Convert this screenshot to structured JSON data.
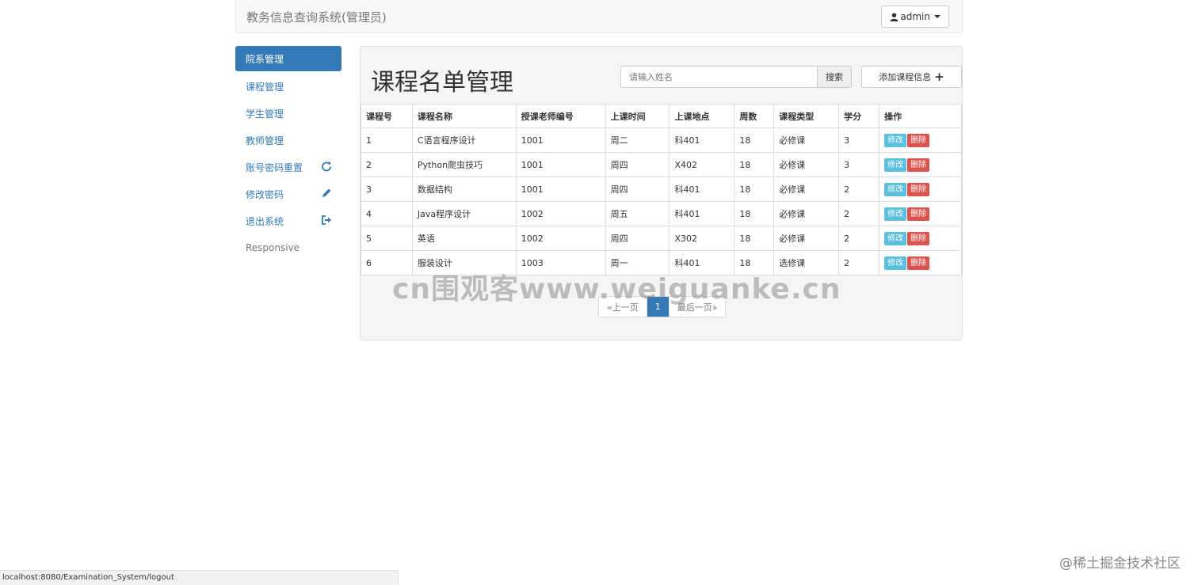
{
  "navbar": {
    "brand": "教务信息查询系统(管理员)",
    "user": "admin"
  },
  "sidebar": {
    "items": [
      {
        "label": "院系管理"
      },
      {
        "label": "课程管理"
      },
      {
        "label": "学生管理"
      },
      {
        "label": "教师管理"
      },
      {
        "label": "账号密码重置",
        "icon": "refresh-icon"
      },
      {
        "label": "修改密码",
        "icon": "pencil-icon"
      },
      {
        "label": "退出系统",
        "icon": "logout-icon"
      },
      {
        "label": "Responsive"
      }
    ]
  },
  "main": {
    "title": "课程名单管理",
    "search_placeholder": "请输入姓名",
    "search_label": "搜索",
    "add_label": "添加课程信息"
  },
  "table": {
    "headers": [
      "课程号",
      "课程名称",
      "授课老师编号",
      "上课时间",
      "上课地点",
      "周数",
      "课程类型",
      "学分",
      "操作"
    ],
    "rows": [
      [
        "1",
        "C语言程序设计",
        "1001",
        "周二",
        "科401",
        "18",
        "必修课",
        "3"
      ],
      [
        "2",
        "Python爬虫技巧",
        "1001",
        "周四",
        "X402",
        "18",
        "必修课",
        "3"
      ],
      [
        "3",
        "数据结构",
        "1001",
        "周四",
        "科401",
        "18",
        "必修课",
        "2"
      ],
      [
        "4",
        "Java程序设计",
        "1002",
        "周五",
        "科401",
        "18",
        "必修课",
        "2"
      ],
      [
        "5",
        "英语",
        "1002",
        "周四",
        "X302",
        "18",
        "必修课",
        "2"
      ],
      [
        "6",
        "服装设计",
        "1003",
        "周一",
        "科401",
        "18",
        "选修课",
        "2"
      ]
    ],
    "edit_label": "修改",
    "delete_label": "删除"
  },
  "pagination": {
    "prev": "«上一页",
    "current": "1",
    "next": "最后一页»"
  },
  "watermark": "cn围观客www.weiguanke.cn",
  "status_url": "localhost:8080/Examination_System/logout",
  "corner_mark": "@稀土掘金技术社区",
  "colors": {
    "primary": "#337ab7",
    "info": "#5bc0de",
    "danger": "#d9534f"
  }
}
